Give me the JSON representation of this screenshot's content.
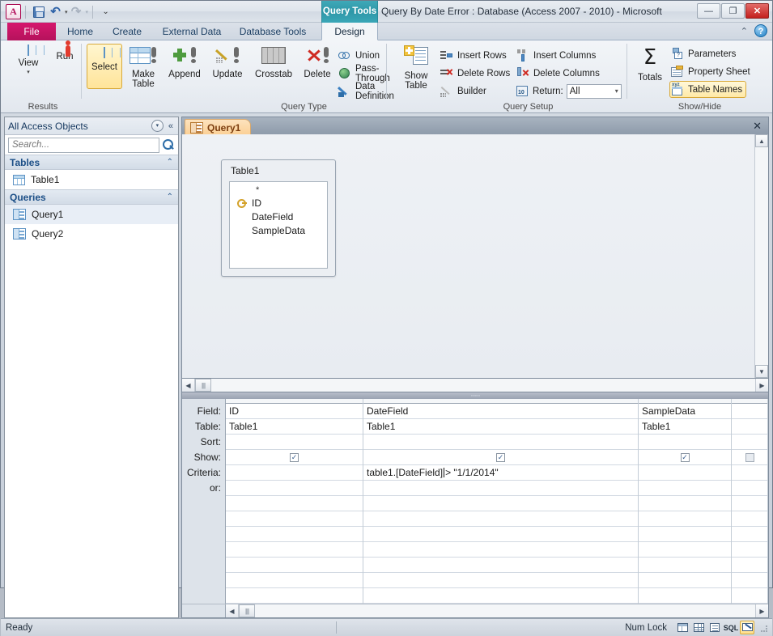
{
  "window": {
    "title": "Query By Date Error : Database (Access 2007 - 2010)  -  Microsoft ...",
    "contextual_tab_group": "Query Tools",
    "minimize_label": "—",
    "restore_label": "❐",
    "close_label": "✕"
  },
  "quick_access": {
    "logo": "A",
    "save": "save-icon",
    "undo": "↶",
    "undo_caret": "▾",
    "redo": "↷",
    "redo_caret": "▾",
    "customize": "☰"
  },
  "tabs": {
    "file": "File",
    "items": [
      {
        "label": "Home",
        "active": false
      },
      {
        "label": "Create",
        "active": false
      },
      {
        "label": "External Data",
        "active": false
      },
      {
        "label": "Database Tools",
        "active": false
      },
      {
        "label": "Design",
        "active": true
      }
    ],
    "collapse_ribbon": "⌃",
    "help": "?"
  },
  "ribbon": {
    "groups": [
      {
        "name": "Results",
        "label": "Results"
      },
      {
        "name": "Query Type",
        "label": "Query Type"
      },
      {
        "name": "Query Setup",
        "label": "Query Setup"
      },
      {
        "name": "Show/Hide",
        "label": "Show/Hide"
      }
    ],
    "results": {
      "view": "View",
      "view_caret": "▾",
      "run": "Run"
    },
    "query_type": {
      "select": "Select",
      "make_table_line1": "Make",
      "make_table_line2": "Table",
      "append": "Append",
      "update": "Update",
      "crosstab": "Crosstab",
      "delete": "Delete",
      "union": "Union",
      "pass_through": "Pass-Through",
      "data_definition": "Data Definition"
    },
    "query_setup": {
      "show_table_line1": "Show",
      "show_table_line2": "Table",
      "insert_rows": "Insert Rows",
      "delete_rows": "Delete Rows",
      "builder": "Builder",
      "insert_columns": "Insert Columns",
      "delete_columns": "Delete Columns",
      "return_label": "Return:",
      "return_value": "All",
      "return_caret": "▾"
    },
    "show_hide": {
      "totals": "Totals",
      "totals_symbol": "Σ",
      "parameters": "Parameters",
      "property_sheet": "Property Sheet",
      "table_names": "Table Names"
    }
  },
  "nav_pane": {
    "title": "All Access Objects",
    "dropdown_caret": "▾",
    "collapse": "«",
    "search_placeholder": "Search...",
    "search_value": "",
    "groups": [
      {
        "label": "Tables",
        "chevron": "⌃",
        "items": [
          {
            "label": "Table1",
            "icon": "table-icon",
            "selected": false
          }
        ]
      },
      {
        "label": "Queries",
        "chevron": "⌃",
        "items": [
          {
            "label": "Query1",
            "icon": "query-icon",
            "selected": true
          },
          {
            "label": "Query2",
            "icon": "query-icon",
            "selected": false
          }
        ]
      }
    ]
  },
  "document": {
    "tab_label": "Query1",
    "close_label": "✕",
    "table_box": {
      "title": "Table1",
      "fields": [
        {
          "label": "*",
          "key": false
        },
        {
          "label": "ID",
          "key": true
        },
        {
          "label": "DateField",
          "key": false
        },
        {
          "label": "SampleData",
          "key": false
        }
      ]
    },
    "scroll": {
      "up": "▲",
      "down": "▼",
      "left": "◀",
      "right": "▶",
      "thumb": "||||",
      "splitter_grip": "∙∙∙∙∙∙∙∙∙"
    }
  },
  "query_grid": {
    "row_labels": [
      "Field:",
      "Table:",
      "Sort:",
      "Show:",
      "Criteria:",
      "or:"
    ],
    "columns": [
      {
        "field": "ID",
        "table": "Table1",
        "sort": "",
        "show": true,
        "criteria": "",
        "or": ""
      },
      {
        "field": "DateField",
        "table": "Table1",
        "sort": "",
        "show": true,
        "criteria": "table1.[DateField]> \"1/1/2014\"",
        "criteria_before_caret": "table1.[DateField]",
        "criteria_after_caret": "> \"1/1/2014\"",
        "or": ""
      },
      {
        "field": "SampleData",
        "table": "Table1",
        "sort": "",
        "show": true,
        "criteria": "",
        "or": ""
      },
      {
        "field": "",
        "table": "",
        "sort": "",
        "show": false,
        "criteria": "",
        "or": ""
      }
    ],
    "checkmark": "✓",
    "scroll_left": "◀",
    "scroll_right": "▶",
    "thumb": "||||"
  },
  "status_bar": {
    "state": "Ready",
    "num_lock": "Num Lock",
    "views": [
      {
        "name": "datasheet-view",
        "active": false
      },
      {
        "name": "pivottable-view",
        "active": false
      },
      {
        "name": "pivotchart-view",
        "active": false
      },
      {
        "name": "sql-view",
        "active": false,
        "label": "SQL"
      },
      {
        "name": "design-view",
        "active": true
      }
    ]
  }
}
